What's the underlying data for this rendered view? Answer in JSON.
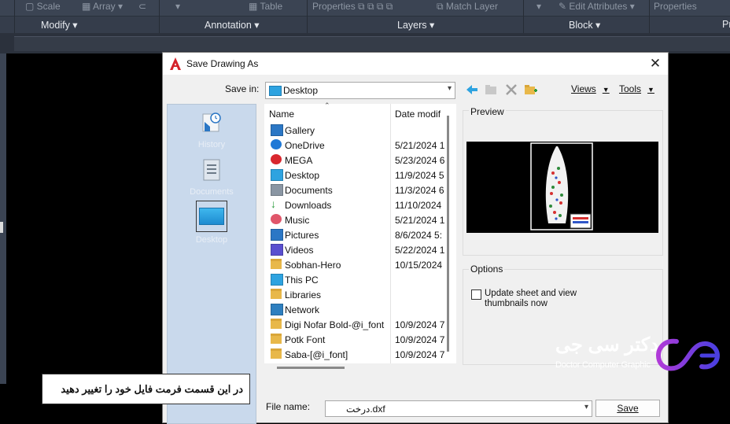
{
  "ribbon": {
    "row1": [
      "Scale",
      "Array",
      "Table",
      "Properties",
      "Match Layer",
      "Edit Attributes",
      "Properties"
    ],
    "panels": [
      "Modify",
      "Annotation",
      "Layers",
      "Block",
      "Pr"
    ]
  },
  "dialog": {
    "title": "Save Drawing As",
    "save_in_label": "Save in:",
    "save_in_value": "Desktop",
    "menus": {
      "views": "Views",
      "tools": "Tools"
    },
    "places": [
      {
        "label": "History",
        "icon": "history-icon"
      },
      {
        "label": "Documents",
        "icon": "documents-icon"
      },
      {
        "label": "Desktop",
        "icon": "desktop-icon"
      }
    ],
    "columns": {
      "name": "Name",
      "date": "Date modif"
    },
    "files": [
      {
        "name": "Gallery",
        "date": "",
        "icon": "gallery-icon"
      },
      {
        "name": "OneDrive",
        "date": "5/21/2024 1",
        "icon": "cloud-icon"
      },
      {
        "name": "MEGA",
        "date": "5/23/2024 6",
        "icon": "mega-icon"
      },
      {
        "name": "Desktop",
        "date": "11/9/2024 5",
        "icon": "desktop-folder-icon"
      },
      {
        "name": "Documents",
        "date": "11/3/2024 6",
        "icon": "document-icon"
      },
      {
        "name": "Downloads",
        "date": "11/10/2024",
        "icon": "download-icon"
      },
      {
        "name": "Music",
        "date": "5/21/2024 1",
        "icon": "music-icon"
      },
      {
        "name": "Pictures",
        "date": "8/6/2024 5:",
        "icon": "pictures-icon"
      },
      {
        "name": "Videos",
        "date": "5/22/2024 1",
        "icon": "videos-icon"
      },
      {
        "name": "Sobhan-Hero",
        "date": "10/15/2024",
        "icon": "folder-icon"
      },
      {
        "name": "This PC",
        "date": "",
        "icon": "pc-icon"
      },
      {
        "name": "Libraries",
        "date": "",
        "icon": "folder-icon"
      },
      {
        "name": "Network",
        "date": "",
        "icon": "network-icon"
      },
      {
        "name": "Digi Nofar Bold-@i_font",
        "date": "10/9/2024 7",
        "icon": "folder-icon"
      },
      {
        "name": "Potk Font",
        "date": "10/9/2024 7",
        "icon": "folder-icon"
      },
      {
        "name": "Saba-[@i_font]",
        "date": "10/9/2024 7",
        "icon": "folder-icon"
      }
    ],
    "preview_label": "Preview",
    "options_label": "Options",
    "option_checkbox": "Update sheet and view thumbnails now",
    "file_name_label": "File name:",
    "file_name_value": "درخت.dxf",
    "save_button": "Save"
  },
  "overlay_note": "در این قسمت فرمت فایل خود را تغییر دهید",
  "brand": {
    "fa": "دکتر سی جی",
    "en": "Doctor Computer Graphic"
  },
  "colors": {
    "accent": "#2ea3e0",
    "folder": "#e8b84a",
    "ribbon": "#3b4453",
    "brand_purple": "#7a3fe0"
  }
}
